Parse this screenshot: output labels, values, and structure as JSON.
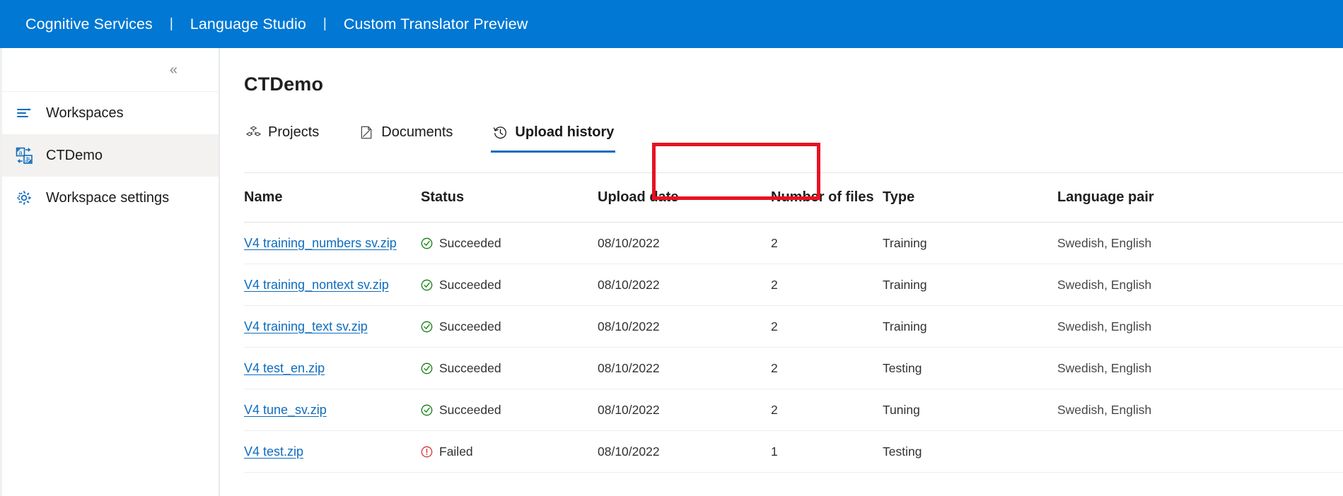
{
  "header": {
    "breadcrumbs": [
      {
        "label": "Cognitive Services"
      },
      {
        "label": "Language Studio"
      },
      {
        "label": "Custom Translator Preview"
      }
    ],
    "separator": "|",
    "background_color": "#0078d4",
    "text_color": "#ffffff"
  },
  "sidebar": {
    "collapse_glyph": "«",
    "items": [
      {
        "label": "Workspaces",
        "icon": "list-icon",
        "selected": false
      },
      {
        "label": "CTDemo",
        "icon": "translate-icon",
        "selected": true
      },
      {
        "label": "Workspace settings",
        "icon": "gear-icon",
        "selected": false
      }
    ]
  },
  "main": {
    "page_title": "CTDemo",
    "tabs": [
      {
        "label": "Projects",
        "icon": "projects-icon",
        "active": false
      },
      {
        "label": "Documents",
        "icon": "documents-icon",
        "active": false
      },
      {
        "label": "Upload history",
        "icon": "history-icon",
        "active": true
      }
    ],
    "active_tab_accent": "#0f6cbd",
    "annotation_color": "#e81123"
  },
  "table": {
    "columns": [
      "Name",
      "Status",
      "Upload date",
      "Number of files",
      "Type",
      "Language pair"
    ],
    "status_colors": {
      "Succeeded": "#107c10",
      "Failed": "#d13438"
    },
    "rows": [
      {
        "name": "V4 training_numbers sv.zip",
        "status": "Succeeded",
        "status_icon": "check-circle-icon",
        "upload_date": "08/10/2022",
        "number_of_files": "2",
        "type": "Training",
        "language_pair": "Swedish, English"
      },
      {
        "name": "V4 training_nontext sv.zip",
        "status": "Succeeded",
        "status_icon": "check-circle-icon",
        "upload_date": "08/10/2022",
        "number_of_files": "2",
        "type": "Training",
        "language_pair": "Swedish, English"
      },
      {
        "name": "V4 training_text sv.zip",
        "status": "Succeeded",
        "status_icon": "check-circle-icon",
        "upload_date": "08/10/2022",
        "number_of_files": "2",
        "type": "Training",
        "language_pair": "Swedish, English"
      },
      {
        "name": "V4 test_en.zip",
        "status": "Succeeded",
        "status_icon": "check-circle-icon",
        "upload_date": "08/10/2022",
        "number_of_files": "2",
        "type": "Testing",
        "language_pair": "Swedish, English"
      },
      {
        "name": "V4 tune_sv.zip",
        "status": "Succeeded",
        "status_icon": "check-circle-icon",
        "upload_date": "08/10/2022",
        "number_of_files": "2",
        "type": "Tuning",
        "language_pair": "Swedish, English"
      },
      {
        "name": "V4 test.zip",
        "status": "Failed",
        "status_icon": "error-circle-icon",
        "upload_date": "08/10/2022",
        "number_of_files": "1",
        "type": "Testing",
        "language_pair": ""
      }
    ]
  }
}
